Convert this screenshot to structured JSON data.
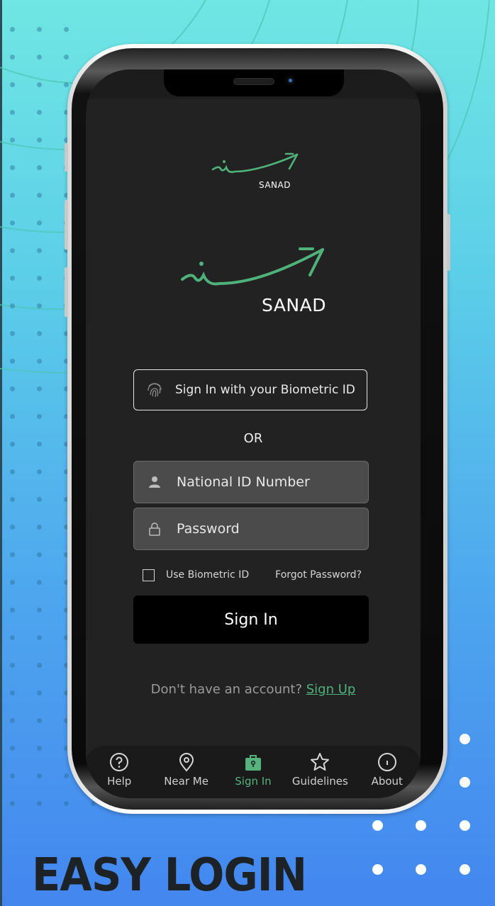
{
  "brand": {
    "name_small": "SANAD",
    "name_large": "SANAD",
    "accent_color": "#56b37e"
  },
  "login": {
    "biometric_button_label": "Sign In with your Biometric ID",
    "or_label": "OR",
    "national_id_placeholder": "National ID Number",
    "password_placeholder": "Password",
    "use_biometric_label": "Use Biometric ID",
    "use_biometric_checked": false,
    "forgot_password_label": "Forgot Password?",
    "sign_in_label": "Sign In",
    "no_account_text": "Don't have an account?",
    "sign_up_label": "Sign Up"
  },
  "tabbar": {
    "items": [
      {
        "label": "Help",
        "icon": "help-icon",
        "active": false
      },
      {
        "label": "Near Me",
        "icon": "location-pin-icon",
        "active": false
      },
      {
        "label": "Sign In",
        "icon": "lock-bag-icon",
        "active": true
      },
      {
        "label": "Guidelines",
        "icon": "star-icon",
        "active": false
      },
      {
        "label": "About",
        "icon": "info-icon",
        "active": false
      }
    ]
  },
  "promo": {
    "headline": "EASY LOGIN"
  }
}
